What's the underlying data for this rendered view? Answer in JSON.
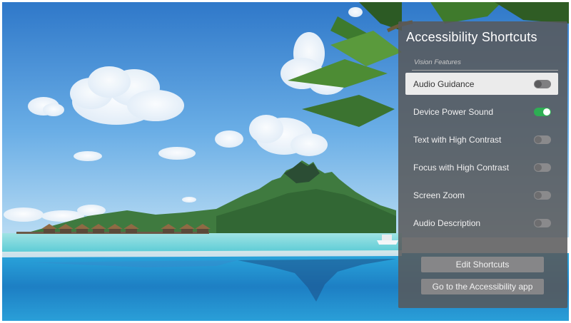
{
  "panel": {
    "title": "Accessibility Shortcuts",
    "section_label": "Vision Features",
    "items": [
      {
        "label": "Audio Guidance",
        "state": "off",
        "focused": true
      },
      {
        "label": "Device Power Sound",
        "state": "on",
        "focused": false
      },
      {
        "label": "Text with High Contrast",
        "state": "off",
        "focused": false
      },
      {
        "label": "Focus with High Contrast",
        "state": "off",
        "focused": false
      },
      {
        "label": "Screen Zoom",
        "state": "off",
        "focused": false
      },
      {
        "label": "Audio Description",
        "state": "off",
        "focused": false
      }
    ],
    "buttons": {
      "edit_label": "Edit Shortcuts",
      "app_label": "Go to the Accessibility app"
    }
  },
  "colors": {
    "panel_bg": "#58585a",
    "toggle_on": "#2eae53",
    "focus_bg": "#ebebeb",
    "button_bg": "#868688"
  },
  "icons": [
    "toggle-switch-icon"
  ]
}
